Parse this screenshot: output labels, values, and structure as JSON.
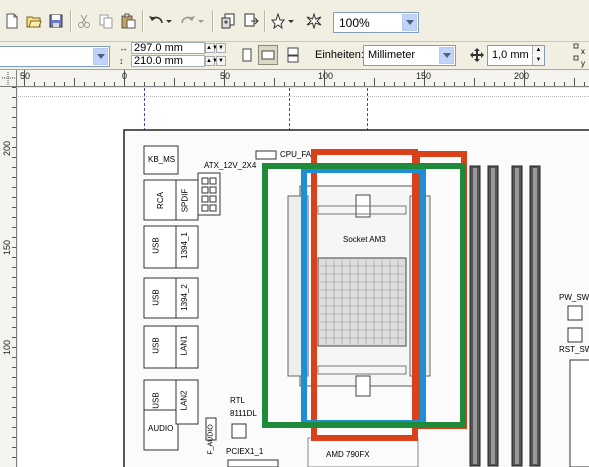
{
  "toolbar": {
    "zoom_value": "100%",
    "icons": [
      "new-icon",
      "open-icon",
      "save-icon",
      "cut-icon",
      "copy-icon",
      "paste-icon",
      "undo-icon",
      "redo-icon",
      "import-icon",
      "export-icon",
      "launcher-icon",
      "app-icon"
    ]
  },
  "property_bar": {
    "paper_size_value": "",
    "width_value": "297.0 mm",
    "height_value": "210.0 mm",
    "units_label": "Einheiten:",
    "units_value": "Millimeter",
    "nudge_value": "1,0 mm"
  },
  "rulers": {
    "horizontal_labels": [
      "50",
      "0",
      "50",
      "100",
      "150",
      "200"
    ],
    "vertical_labels": [
      "200",
      "150",
      "100"
    ]
  },
  "image_labels": {
    "kb_ms": "KB_MS",
    "atx": "ATX_12V_2X4",
    "cpu_fan": "CPU_FA",
    "rca": "RCA",
    "spdif": "SPDIF",
    "usb1": "USB",
    "usb1b": "1394_1",
    "usb2": "USB",
    "usb2b": "1394_2",
    "socket": "Socket AM3",
    "usb3": "USB",
    "lan1": "LAN1",
    "usb4": "USB",
    "lan2": "LAN2",
    "pw_sw": "PW_SW",
    "rst_sw": "RST_SW",
    "audio": "AUDIO",
    "rtl": "RTL",
    "rtl2": "8111DL",
    "f_audio": "F_AUDIO",
    "pciex": "PCIEX1_1",
    "amd": "AMD 790FX"
  },
  "colors": {
    "green_box": "#1f8a3a",
    "red_box": "#d9411b",
    "blue_box": "#1d8fd6",
    "guide": "#3c49a6"
  }
}
